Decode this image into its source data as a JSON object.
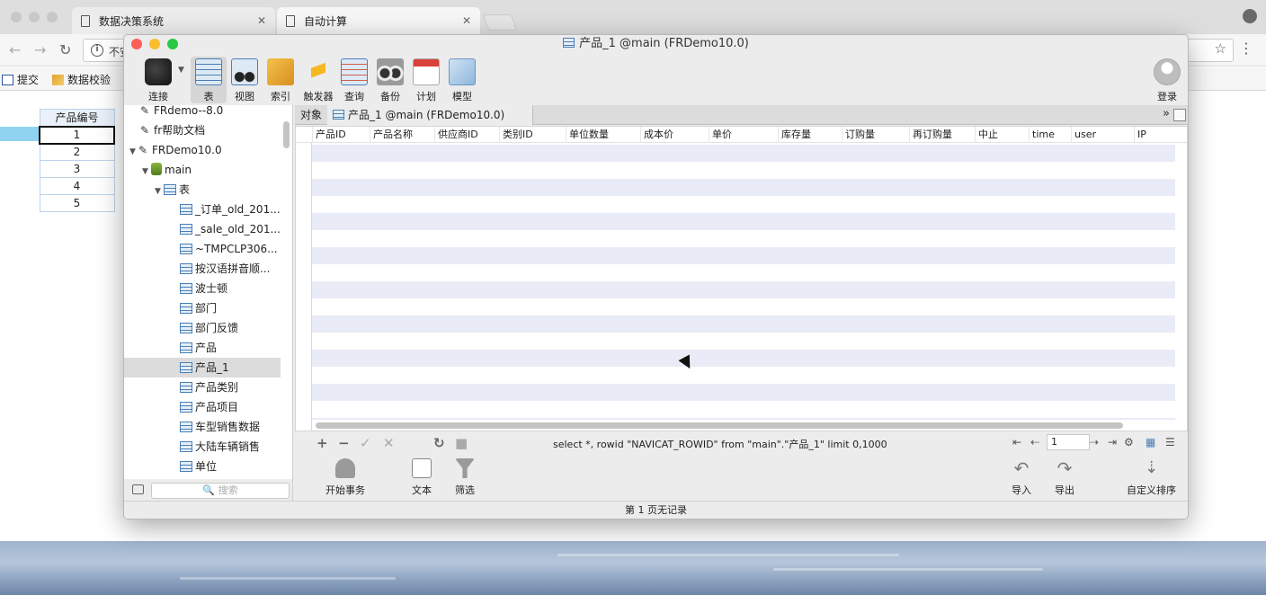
{
  "browser": {
    "tabs": [
      {
        "label": "数据决策系统"
      },
      {
        "label": "自动计算"
      }
    ],
    "address_text": "不安",
    "bookmarks": [
      {
        "label": "提交"
      },
      {
        "label": "数据校验"
      }
    ]
  },
  "sheet": {
    "header": "产品编号",
    "rows": [
      "1",
      "2",
      "3",
      "4",
      "5"
    ]
  },
  "window": {
    "title": "产品_1 @main (FRDemo10.0)",
    "toolbar": [
      {
        "label": "连接"
      },
      {
        "label": "表"
      },
      {
        "label": "视图"
      },
      {
        "label": "索引"
      },
      {
        "label": "触发器"
      },
      {
        "label": "查询"
      },
      {
        "label": "备份"
      },
      {
        "label": "计划"
      },
      {
        "label": "模型"
      }
    ],
    "login_label": "登录"
  },
  "tree": {
    "items": [
      {
        "label": "FRdemo--8.0"
      },
      {
        "label": "fr帮助文档"
      },
      {
        "label": "FRDemo10.0"
      },
      {
        "label": "main"
      },
      {
        "label": "表"
      },
      {
        "label": "_订单_old_201..."
      },
      {
        "label": "_sale_old_201..."
      },
      {
        "label": "~TMPCLP306..."
      },
      {
        "label": "按汉语拼音顺..."
      },
      {
        "label": "波士顿"
      },
      {
        "label": "部门"
      },
      {
        "label": "部门反馈"
      },
      {
        "label": "产品"
      },
      {
        "label": "产品_1"
      },
      {
        "label": "产品类别"
      },
      {
        "label": "产品项目"
      },
      {
        "label": "车型销售数据"
      },
      {
        "label": "大陆车辆销售"
      },
      {
        "label": "单位"
      }
    ],
    "search_placeholder": "搜索"
  },
  "doc_tabs": {
    "objects_label": "对象",
    "active_label": "产品_1 @main (FRDemo10.0)"
  },
  "grid": {
    "columns": [
      "产品ID",
      "产品名称",
      "供应商ID",
      "类别ID",
      "单位数量",
      "成本价",
      "单价",
      "库存量",
      "订购量",
      "再订购量",
      "中止",
      "time",
      "user",
      "IP"
    ]
  },
  "status": {
    "sql": "select *, rowid \"NAVICAT_ROWID\" from \"main\".\"产品_1\"  limit 0,1000",
    "page_value": "1",
    "bottom_text": "第 1 页无记录"
  },
  "actions": [
    {
      "label": "开始事务"
    },
    {
      "label": "文本"
    },
    {
      "label": "筛选"
    },
    {
      "label": "导入"
    },
    {
      "label": "导出"
    },
    {
      "label": "自定义排序"
    }
  ]
}
